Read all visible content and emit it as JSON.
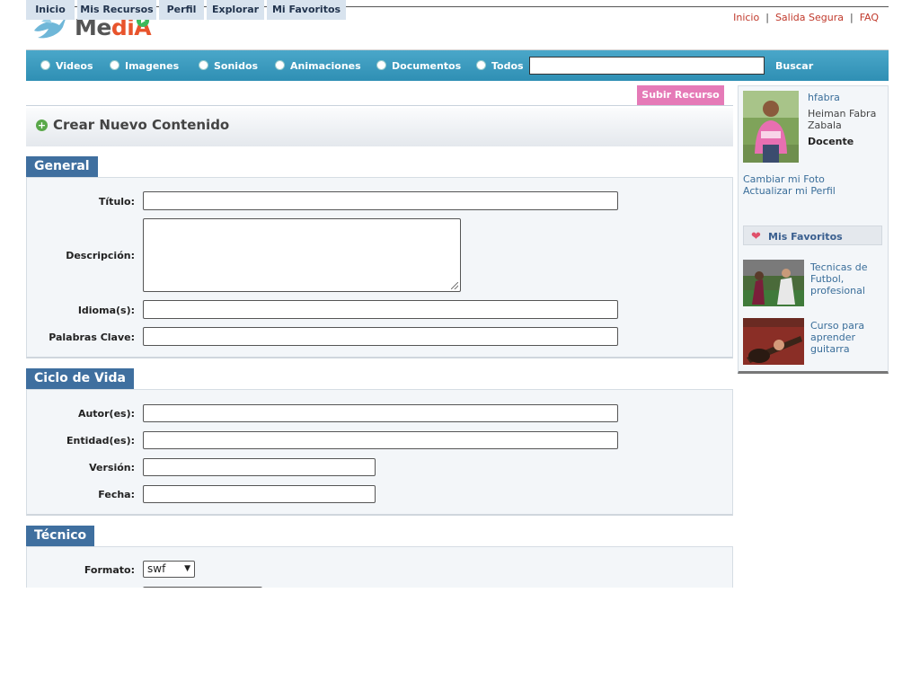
{
  "logo": {
    "text_a": "Me",
    "text_b": "diA"
  },
  "top_links": [
    "Inicio",
    "Salida Segura",
    "FAQ"
  ],
  "search": {
    "options": [
      "Videos",
      "Imagenes",
      "Sonidos",
      "Animaciones",
      "Documentos",
      "Todos"
    ],
    "value": "",
    "button": "Buscar"
  },
  "tabs": [
    "Inicio",
    "Mis Recursos",
    "Perfil",
    "Explorar",
    "Mi Favoritos"
  ],
  "upload_button": "Subir Recurso",
  "create_title": "Crear Nuevo Contenido",
  "sections": {
    "general": {
      "title": "General",
      "titulo_label": "Título:",
      "descripcion_label": "Descripción:",
      "idioma_label": "Idioma(s):",
      "palabras_label": "Palabras Clave:"
    },
    "ciclo": {
      "title": "Ciclo de Vida",
      "autor_label": "Autor(es):",
      "entidad_label": "Entidad(es):",
      "version_label": "Versión:",
      "fecha_label": "Fecha:"
    },
    "tecnico": {
      "title": "Técnico",
      "formato_label": "Formato:",
      "formato_value": "swf"
    }
  },
  "sidebar": {
    "username": "hfabra",
    "full_name": "Heiman Fabra Zabala",
    "role": "Docente",
    "change_photo": "Cambiar mi Foto",
    "update_profile": "Actualizar mi Perfil",
    "favorites_title": "Mis Favoritos",
    "favorites": [
      {
        "label": "Tecnicas de Futbol, profesional"
      },
      {
        "label": "Curso para aprender guitarra"
      }
    ]
  },
  "colors": {
    "nav_bar": "#3a9cc2",
    "section_tab": "#3f6f9f",
    "upload_button": "#e57ab7",
    "top_link": "#c0392b"
  }
}
